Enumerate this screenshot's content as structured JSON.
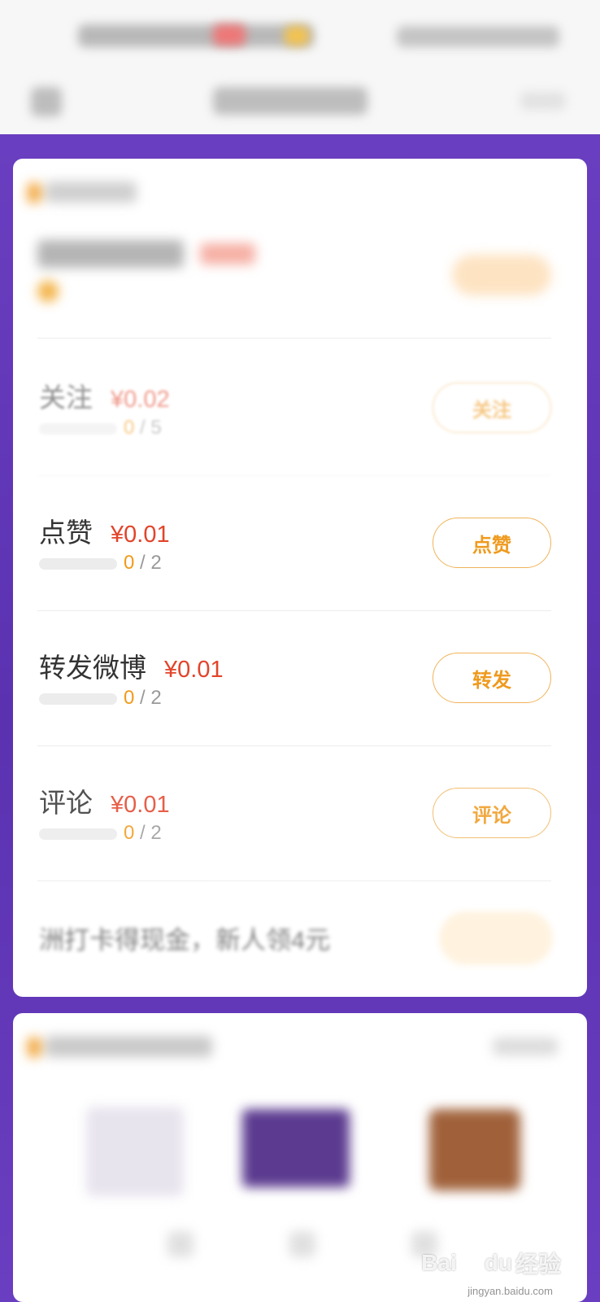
{
  "colors": {
    "accent": "#ef9a1e",
    "reward": "#e2442a",
    "background_purple": "#5a32b0"
  },
  "tasks": [
    {
      "title": "关注",
      "reward": "¥0.02",
      "done": "0",
      "total": "/ 5",
      "progress": 0,
      "button": "关注"
    },
    {
      "title": "点赞",
      "reward": "¥0.01",
      "done": "0",
      "total": "/ 2",
      "progress": 0,
      "button": "点赞"
    },
    {
      "title": "转发微博",
      "reward": "¥0.01",
      "done": "0",
      "total": "/ 2",
      "progress": 0,
      "button": "转发"
    },
    {
      "title": "评论",
      "reward": "¥0.01",
      "done": "0",
      "total": "/ 2",
      "progress": 0,
      "button": "评论"
    }
  ],
  "banner": {
    "text": "洲打卡得现金，新人领4元"
  },
  "watermark": {
    "brand": "Bai",
    "brand2": "du",
    "cn": "经验",
    "url": "jingyan.baidu.com"
  }
}
